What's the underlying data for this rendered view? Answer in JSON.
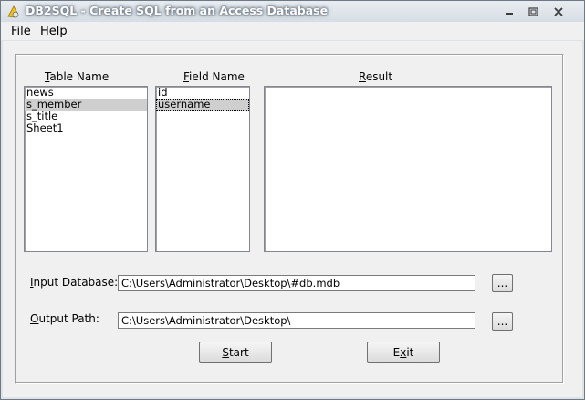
{
  "window": {
    "title": "DB2SQL - Create SQL from an Access Database"
  },
  "menu": {
    "file": "File",
    "help": "Help"
  },
  "columns": {
    "table_name": {
      "pre": "",
      "ul": "T",
      "post": "able Name"
    },
    "field_name": {
      "pre": "",
      "ul": "F",
      "post": "ield Name"
    },
    "result": {
      "pre": "",
      "ul": "R",
      "post": "esult"
    }
  },
  "tables": [
    "news",
    "s_member",
    "s_title",
    "Sheet1"
  ],
  "fields": [
    "id",
    "username"
  ],
  "input_database": {
    "label_pre": "",
    "label_ul": "I",
    "label_post": "nput Database:",
    "value": "C:\\Users\\Administrator\\Desktop\\#db.mdb",
    "browse_label": "..."
  },
  "output_path": {
    "label_pre": "",
    "label_ul": "O",
    "label_post": "utput Path:",
    "value": "C:\\Users\\Administrator\\Desktop\\",
    "browse_label": "..."
  },
  "buttons": {
    "start": {
      "ul": "S",
      "post": "tart"
    },
    "exit": {
      "pre": "E",
      "ul": "x",
      "post": "it"
    }
  }
}
